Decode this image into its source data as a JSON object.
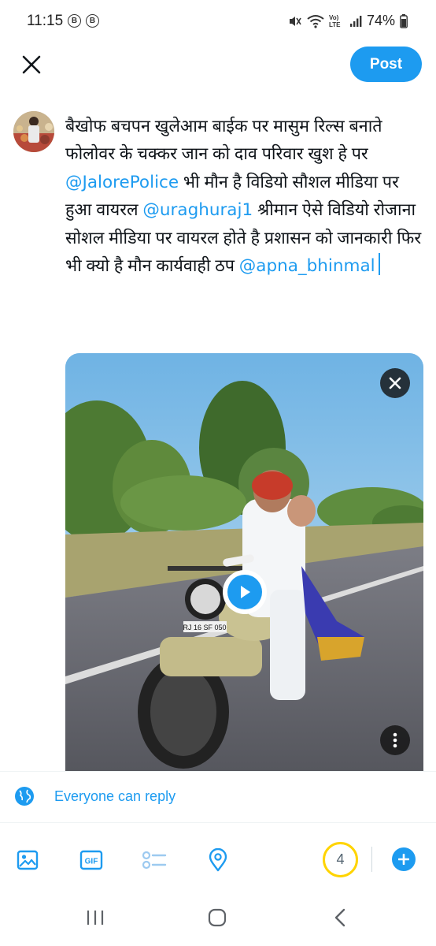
{
  "status_bar": {
    "time": "11:15",
    "badges": [
      "B",
      "B"
    ],
    "network_label": "Vo) LTE",
    "battery": "74%"
  },
  "compose": {
    "post_label": "Post",
    "accent_color": "#1d9bf0",
    "text_segments": [
      {
        "text": "बैखोफ बचपन खुलेआम बाईक पर मासुम रिल्स बनाते फोलोवर के चक्कर जान को दाव परिवार खुश हे पर ",
        "mention": false
      },
      {
        "text": "@JalorePolice",
        "mention": true
      },
      {
        "text": " भी मौन है विडियो सौशल मीडिया पर हुआ वायरल ",
        "mention": false
      },
      {
        "text": "@uraghuraj1",
        "mention": true
      },
      {
        "text": " श्रीमान ऐसे विडियो रोजाना सोशल मीडिया पर वायरल होते है प्रशासन को जानकारी फिर भी क्यो है मौन कार्यवाही ठप ",
        "mention": false
      },
      {
        "text": "@apna_bhinmal",
        "mention": true
      }
    ]
  },
  "media": {
    "plate_text": "RJ 16 SF 050"
  },
  "reply_settings": {
    "label": "Everyone can reply"
  },
  "toolbar": {
    "icons": [
      "image-icon",
      "gif-icon",
      "poll-icon",
      "location-icon"
    ],
    "gif_label": "GIF",
    "remaining_count": "4",
    "counter_color": "#ffd400"
  },
  "nav_bar": {
    "icons": [
      "recents-icon",
      "home-icon",
      "back-icon"
    ]
  }
}
